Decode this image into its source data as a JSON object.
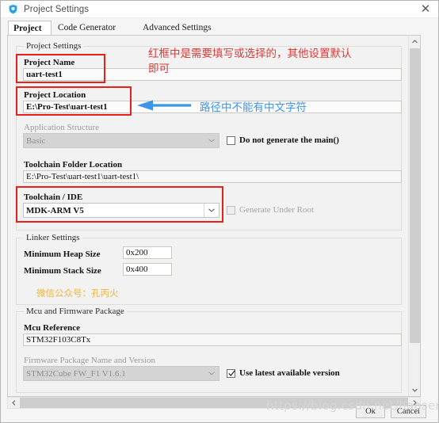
{
  "window": {
    "title": "Project Settings",
    "icon": "stm32cubemx-shield-icon",
    "close_label": "✕"
  },
  "tabs": [
    {
      "label": "Project",
      "active": true
    },
    {
      "label": "Code Generator",
      "active": false
    },
    {
      "label": "Advanced Settings",
      "active": false
    }
  ],
  "groups": {
    "project_settings": {
      "title": "Project Settings"
    },
    "linker_settings": {
      "title": "Linker Settings"
    },
    "mcu_firmware": {
      "title": "Mcu and Firmware Package"
    }
  },
  "fields": {
    "project_name": {
      "label": "Project Name",
      "value": "uart-test1"
    },
    "project_location": {
      "label": "Project Location",
      "value": "E:\\Pro-Test\\uart-test1"
    },
    "application_structure": {
      "label": "Application Structure",
      "value": "Basic",
      "disabled": true
    },
    "do_not_generate_main": {
      "label": "Do not generate the main()",
      "checked": false
    },
    "toolchain_folder_location": {
      "label": "Toolchain Folder Location",
      "value": "E:\\Pro-Test\\uart-test1\\uart-test1\\"
    },
    "toolchain_ide": {
      "label": "Toolchain / IDE",
      "value": "MDK-ARM V5"
    },
    "generate_under_root": {
      "label": "Generate Under Root",
      "checked": false,
      "disabled": true
    },
    "minimum_heap_size": {
      "label": "Minimum Heap Size",
      "value": "0x200"
    },
    "minimum_stack_size": {
      "label": "Minimum Stack Size",
      "value": "0x400"
    },
    "mcu_reference": {
      "label": "Mcu Reference",
      "value": "STM32F103C8Tx"
    },
    "firmware_package": {
      "label": "Firmware Package Name and Version",
      "value": "STM32Cube FW_F1 V1.6.1",
      "disabled": true
    },
    "use_latest_version": {
      "label": "Use latest available version",
      "checked": true
    }
  },
  "annotations": {
    "red_note": "红框中是需要填写或选择的，其他设置默认\n即可",
    "blue_note": "路径中不能有中文字符",
    "orange_watermark": "微信公众号：孔丙火",
    "csdn_watermark": "https://blog.csdn.net/haoserem"
  },
  "buttons": {
    "ok": "Ok",
    "cancel": "Cancel"
  },
  "colors": {
    "highlight_red": "#e8201a",
    "annotation_red": "#d93b37",
    "annotation_blue": "#3d95e8",
    "annotation_orange": "#f0b23c",
    "accent_blue": "#4f8fe0"
  }
}
